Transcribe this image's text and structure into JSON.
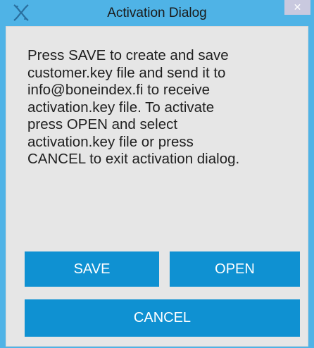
{
  "window": {
    "title": "Activation Dialog",
    "close_label": "✕"
  },
  "dialog": {
    "message": "Press SAVE to create and save\ncustomer.key file and send it to\ninfo@boneindex.fi to receive\nactivation.key file. To activate\npress OPEN and select\nactivation.key file or press\nCANCEL to exit activation dialog."
  },
  "buttons": {
    "save_label": "SAVE",
    "open_label": "OPEN",
    "cancel_label": "CANCEL"
  },
  "icons": {
    "app": "app-logo-icon",
    "close": "close-icon"
  },
  "colors": {
    "titlebar": "#4fb3e6",
    "button": "#0f91d2",
    "client": "#e6e6e6"
  }
}
